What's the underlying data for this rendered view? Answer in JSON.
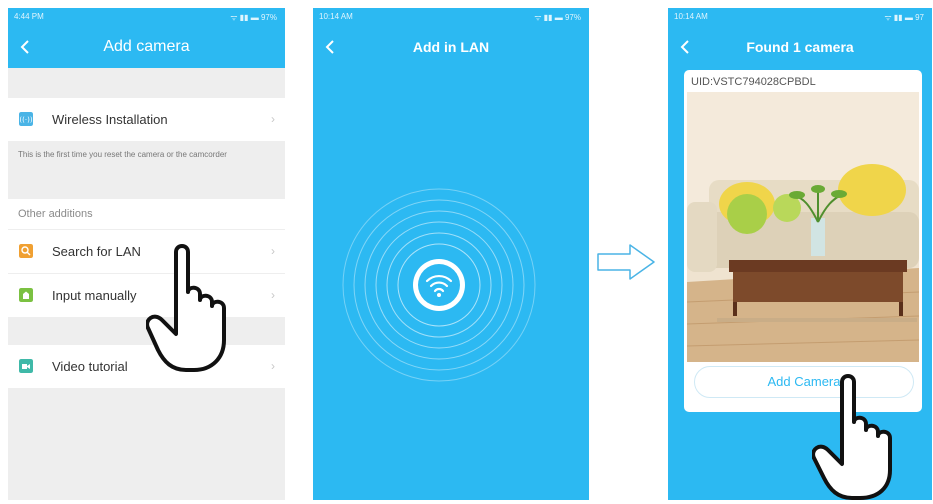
{
  "screen1": {
    "status_time": "4:44 PM",
    "status_icons": "ᯤ ▮▮ ▬ 97%",
    "title": "Add camera",
    "wireless_label": "Wireless Installation",
    "note": "This is the first time you reset the camera or the camcorder",
    "section_label": "Other additions",
    "search_label": "Search for LAN",
    "manual_label": "Input manually",
    "video_label": "Video tutorial",
    "chevron": "›"
  },
  "screen2": {
    "status_time": "10:14 AM",
    "status_icons": "ᯤ ▮▮ ▬ 97%",
    "title": "Add in LAN"
  },
  "screen3": {
    "status_time": "10:14 AM",
    "status_icons": "ᯤ ▮▮ ▬ 97",
    "title": "Found 1 camera",
    "uid": "UID:VSTC794028CPBDL",
    "button_label": "Add Camera"
  },
  "colors": {
    "accent": "#2cb9f2",
    "background": "#eeeeee",
    "text": "#333333"
  },
  "icons": [
    "back-icon",
    "wifi-icon",
    "search-icon",
    "home-icon",
    "video-icon",
    "arrow-right-icon",
    "hand-pointer-icon"
  ]
}
